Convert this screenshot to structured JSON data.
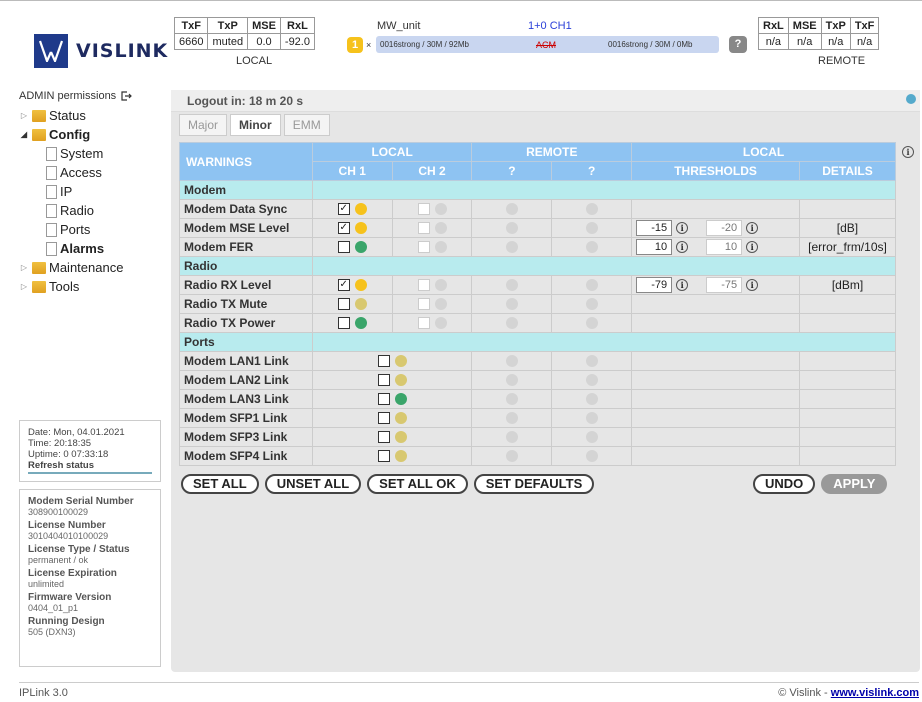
{
  "brand": {
    "name": "VISLINK"
  },
  "local_stats": {
    "headers": [
      "TxF",
      "TxP",
      "MSE",
      "RxL"
    ],
    "values": [
      "6660",
      "muted",
      "0.0",
      "-92.0"
    ],
    "label": "LOCAL"
  },
  "remote_stats": {
    "headers": [
      "RxL",
      "MSE",
      "TxP",
      "TxF"
    ],
    "values": [
      "n/a",
      "n/a",
      "n/a",
      "n/a"
    ],
    "label": "REMOTE"
  },
  "unit": {
    "name": "MW_unit",
    "channel": "1+0 CH1",
    "count": "1",
    "left_rate": "0016strong / 30M / 92Mb",
    "mode": "ACM",
    "right_rate": "0016strong / 30M / 0Mb",
    "help": "?"
  },
  "sidebar": {
    "permissions": "ADMIN permissions",
    "items": [
      "Status",
      "Config",
      "System",
      "Access",
      "IP",
      "Radio",
      "Ports",
      "Alarms",
      "Maintenance",
      "Tools"
    ]
  },
  "status_box": {
    "date": "Date: Mon, 04.01.2021",
    "time": "Time: 20:18:35",
    "uptime": "Uptime: 0 07:33:18",
    "refresh": "Refresh status"
  },
  "device_info": [
    {
      "k": "Modem Serial Number",
      "v": "308900100029"
    },
    {
      "k": "License Number",
      "v": "3010404010100029"
    },
    {
      "k": "License Type / Status",
      "v": "permanent / ok"
    },
    {
      "k": "License Expiration",
      "v": "unlimited"
    },
    {
      "k": "Firmware Version",
      "v": "0404_01_p1"
    },
    {
      "k": "Running Design",
      "v": "505 (DXN3)"
    }
  ],
  "logout": "Logout in: 18 m 20 s",
  "tabs": [
    "Major",
    "Minor",
    "EMM"
  ],
  "table": {
    "h_warnings": "WARNINGS",
    "h_local": "LOCAL",
    "h_remote": "REMOTE",
    "h_local2": "LOCAL",
    "h_ch1": "CH 1",
    "h_ch2": "CH 2",
    "h_q1": "?",
    "h_q2": "?",
    "h_thresholds": "THRESHOLDS",
    "h_details": "DETAILS",
    "sections": {
      "modem": "Modem",
      "radio": "Radio",
      "ports": "Ports"
    },
    "rows": [
      {
        "name": "Modem Data Sync",
        "t1": "",
        "t2": "",
        "detail": ""
      },
      {
        "name": "Modem MSE Level",
        "t1": "-15",
        "t2": "-20",
        "detail": "[dB]"
      },
      {
        "name": "Modem FER",
        "t1": "10",
        "t2": "10",
        "detail": "[error_frm/10s]"
      },
      {
        "name": "Radio RX Level",
        "t1": "-79",
        "t2": "-75",
        "detail": "[dBm]"
      },
      {
        "name": "Radio TX Mute",
        "t1": "",
        "t2": "",
        "detail": ""
      },
      {
        "name": "Radio TX Power",
        "t1": "",
        "t2": "",
        "detail": ""
      },
      {
        "name": "Modem LAN1 Link"
      },
      {
        "name": "Modem LAN2 Link"
      },
      {
        "name": "Modem LAN3 Link"
      },
      {
        "name": "Modem SFP1 Link"
      },
      {
        "name": "Modem SFP3 Link"
      },
      {
        "name": "Modem SFP4 Link"
      }
    ]
  },
  "buttons": {
    "set_all": "SET ALL",
    "unset_all": "UNSET ALL",
    "set_all_ok": "SET ALL OK",
    "set_defaults": "SET DEFAULTS",
    "undo": "UNDO",
    "apply": "APPLY"
  },
  "footer": {
    "version": "IPLink 3.0",
    "copyright": "© Vislink - ",
    "link": "www.vislink.com"
  },
  "colors": {
    "yellow": "#f6c21c",
    "green": "#3aa56a",
    "olive": "#d8c870",
    "grey": "#d4d4d4",
    "header_blue": "#8ec3f2",
    "section_cyan": "#b8ebee"
  }
}
